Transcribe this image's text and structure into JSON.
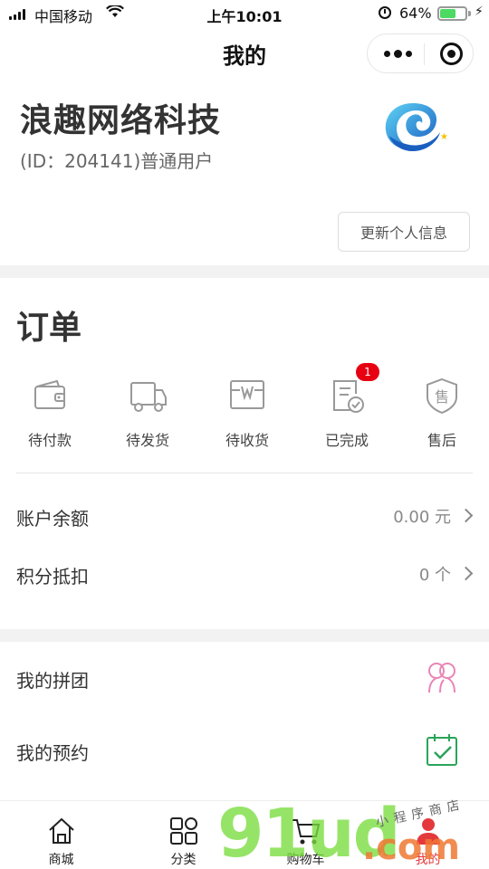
{
  "status_bar": {
    "carrier": "中国移动",
    "time": "上午10:01",
    "battery_percent": "64%",
    "battery_level": 0.64
  },
  "nav": {
    "title": "我的"
  },
  "profile": {
    "company_name": "浪趣网络科技",
    "user_id_text": "(ID：204141)普通用户",
    "update_button": "更新个人信息"
  },
  "orders": {
    "title": "订单",
    "items": [
      {
        "label": "待付款",
        "icon": "wallet-icon"
      },
      {
        "label": "待发货",
        "icon": "truck-icon"
      },
      {
        "label": "待收货",
        "icon": "box-icon"
      },
      {
        "label": "已完成",
        "icon": "completed-doc-icon",
        "badge": "1"
      },
      {
        "label": "售后",
        "icon": "after-sales-shield-icon"
      }
    ]
  },
  "account": {
    "balance_label": "账户余额",
    "balance_value": "0.00 元",
    "points_label": "积分抵扣",
    "points_value": "0 个"
  },
  "extras": {
    "group_buy_label": "我的拼团",
    "reservation_label": "我的预约",
    "group_buy_icon": "group-icon",
    "reservation_icon": "calendar-check-icon"
  },
  "tab_bar": {
    "items": [
      {
        "label": "商城",
        "icon": "home-icon"
      },
      {
        "label": "分类",
        "icon": "category-grid-icon"
      },
      {
        "label": "购物车",
        "icon": "cart-icon"
      },
      {
        "label": "我的",
        "icon": "user-icon"
      }
    ],
    "active_index": 3
  },
  "colors": {
    "accent_red": "#e4393c",
    "badge_red": "#e60012",
    "battery_green": "#4cd964",
    "group_icon_pink": "#e986b6",
    "calendar_icon_green": "#2aa45a"
  },
  "watermark": {
    "text": "91ud",
    "suffix": ".com",
    "sub_text": "小程序商店"
  }
}
